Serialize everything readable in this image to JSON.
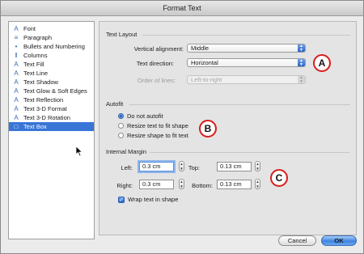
{
  "window": {
    "title": "Format Text"
  },
  "sidebar": {
    "items": [
      {
        "label": "Font",
        "icon": "font-icon",
        "glyph": "A"
      },
      {
        "label": "Paragraph",
        "icon": "paragraph-icon",
        "glyph": "≡"
      },
      {
        "label": "Bullets and Numbering",
        "icon": "bullets-icon",
        "glyph": "•"
      },
      {
        "label": "Columns",
        "icon": "columns-icon",
        "glyph": "‖"
      },
      {
        "label": "Text Fill",
        "icon": "text-fill-icon",
        "glyph": "A"
      },
      {
        "label": "Text Line",
        "icon": "text-line-icon",
        "glyph": "A"
      },
      {
        "label": "Text Shadow",
        "icon": "text-shadow-icon",
        "glyph": "A"
      },
      {
        "label": "Text Glow & Soft Edges",
        "icon": "text-glow-icon",
        "glyph": "A"
      },
      {
        "label": "Text Reflection",
        "icon": "text-reflection-icon",
        "glyph": "A"
      },
      {
        "label": "Text 3-D Format",
        "icon": "text-3d-format-icon",
        "glyph": "A"
      },
      {
        "label": "Text 3-D Rotation",
        "icon": "text-3d-rotation-icon",
        "glyph": "A"
      },
      {
        "label": "Text Box",
        "icon": "text-box-icon",
        "glyph": "□",
        "selected": true
      }
    ]
  },
  "text_layout": {
    "title": "Text Layout",
    "vertical_alignment_label": "Vertical alignment:",
    "vertical_alignment_value": "Middle",
    "text_direction_label": "Text direction:",
    "text_direction_value": "Horizontal",
    "order_of_lines_label": "Order of lines:",
    "order_of_lines_value": "Left-to-right"
  },
  "autofit": {
    "title": "Autofit",
    "options": [
      "Do not autofit",
      "Resize text to fit shape",
      "Resize shape to fit text"
    ],
    "selected": "Do not autofit"
  },
  "internal_margin": {
    "title": "Internal Margin",
    "left_label": "Left:",
    "left_value": "0.3 cm",
    "top_label": "Top:",
    "top_value": "0.13 cm",
    "right_label": "Right:",
    "right_value": "0.3 cm",
    "bottom_label": "Bottom:",
    "bottom_value": "0.13 cm",
    "wrap_label": "Wrap text in shape",
    "wrap_checked": true
  },
  "callouts": {
    "a": "A",
    "b": "B",
    "c": "C"
  },
  "buttons": {
    "cancel": "Cancel",
    "ok": "OK"
  },
  "colors": {
    "selection": "#3875d7",
    "callout_ring": "#d81e1e",
    "accent": "#2b64c9"
  }
}
